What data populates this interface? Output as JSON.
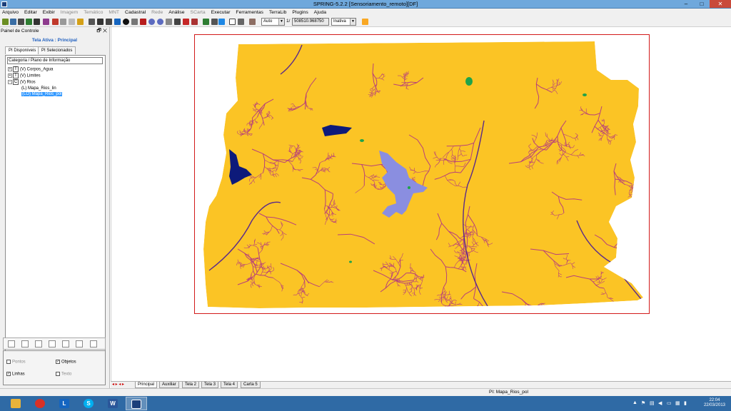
{
  "window": {
    "title": "SPRING-5.2.2 [Sensoriamento_remoto][DF]",
    "controls": [
      "–",
      "□",
      "✕"
    ]
  },
  "menu": [
    {
      "label": "Arquivo",
      "enabled": true
    },
    {
      "label": "Editar",
      "enabled": true
    },
    {
      "label": "Exibir",
      "enabled": true
    },
    {
      "label": "Imagem",
      "enabled": false
    },
    {
      "label": "Temático",
      "enabled": false
    },
    {
      "label": "MNT",
      "enabled": false
    },
    {
      "label": "Cadastral",
      "enabled": true
    },
    {
      "label": "Rede",
      "enabled": false
    },
    {
      "label": "Análise",
      "enabled": true
    },
    {
      "label": "SCarta",
      "enabled": false
    },
    {
      "label": "Executar",
      "enabled": true
    },
    {
      "label": "Ferramentas",
      "enabled": true
    },
    {
      "label": "TerraLib",
      "enabled": true
    },
    {
      "label": "Plugins",
      "enabled": true
    },
    {
      "label": "Ajuda",
      "enabled": true
    }
  ],
  "toolbar": {
    "zoom_mode": "Auto",
    "scale_label": "1/",
    "scale_value": "508510.968750",
    "state": "Inativa"
  },
  "panel": {
    "title": "Painel de Controle",
    "header_icons": "🗗 ✕",
    "active_screen": "Tela Ativa : Principal",
    "tabs": [
      "PI Disponíveis",
      "PI Selecionados"
    ],
    "tree_header": "Categoria / Plano de Informação",
    "tree": [
      {
        "expander": "+",
        "icon": "T",
        "label": "(V) Corpos_Agua"
      },
      {
        "expander": "+",
        "icon": "T",
        "label": "(V) Limites"
      },
      {
        "expander": "−",
        "icon": "C",
        "label": "(V) Rios"
      },
      {
        "expander": "",
        "icon": "",
        "label": "(L) Mapa_Rios_lin"
      },
      {
        "expander": "",
        "icon": "",
        "label": "(LO) Mapa_Rios_pol",
        "selected": true
      }
    ],
    "visibility": {
      "pontos": {
        "label": "Pontos",
        "checked": false,
        "enabled": false
      },
      "objetos": {
        "label": "Objetos",
        "checked": true,
        "enabled": true
      },
      "linhas": {
        "label": "Linhas",
        "checked": true,
        "enabled": true
      },
      "texto": {
        "label": "Texto",
        "checked": false,
        "enabled": false
      }
    }
  },
  "map": {
    "fill_color": "#fbc425",
    "river_color": "#b8407a",
    "dark_water_color": "#0d1a7a",
    "lake_color": "#8a8ee0",
    "frame_color": "#d21a1a"
  },
  "screen_tabs": [
    "Principal",
    "Auxiliar",
    "Tela 2",
    "Tela 3",
    "Tela 4",
    "Carta 5"
  ],
  "status": "PI: Mapa_Rios_pol",
  "taskbar": {
    "apps": [
      "file-explorer-icon",
      "chrome-icon",
      "lync-icon",
      "skype-icon",
      "word-icon",
      "spring-icon"
    ],
    "time": "22:04",
    "date": "22/03/2013"
  }
}
